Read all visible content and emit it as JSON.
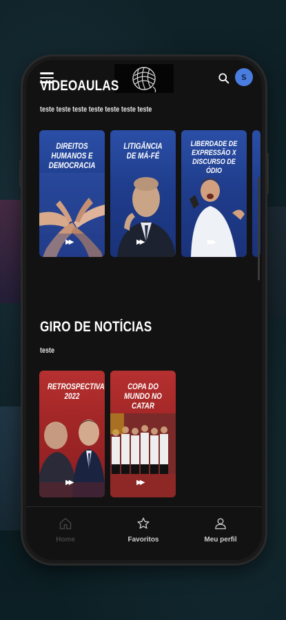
{
  "header": {
    "menu_icon": "hamburger-icon",
    "logo": "yarn-ball-logo",
    "search_icon": "search-icon",
    "avatar_initial": "S"
  },
  "sections": [
    {
      "title": "VIDEOAULAS",
      "subtitle": "teste teste teste teste teste teste teste",
      "cards": [
        {
          "title": "DIREITOS HUMANOS E DEMOCRACIA",
          "color": "#2b4fa7",
          "image": "hands-together"
        },
        {
          "title": "LITIGÂNCIA DE MÁ-FÉ",
          "color": "#2b4fa7",
          "image": "man-in-suit"
        },
        {
          "title": "LIBERDADE DE EXPRESSÃO X DISCURSO DE ÓDIO",
          "color": "#2b4fa7",
          "image": "man-shouting-phone"
        }
      ]
    },
    {
      "title": "GIRO DE NOTÍCIAS",
      "subtitle": "teste",
      "cards": [
        {
          "title": "RETROSPECTIVA 2022",
          "color": "#b63030",
          "image": "two-politicians"
        },
        {
          "title": "COPA DO MUNDO NO CATAR",
          "color": "#b63030",
          "image": "football-team"
        }
      ]
    }
  ],
  "bottom_nav": [
    {
      "label": "Home",
      "icon": "home-icon",
      "active": true
    },
    {
      "label": "Favoritos",
      "icon": "star-icon",
      "active": false
    },
    {
      "label": "Meu perfil",
      "icon": "user-icon",
      "active": false
    }
  ]
}
